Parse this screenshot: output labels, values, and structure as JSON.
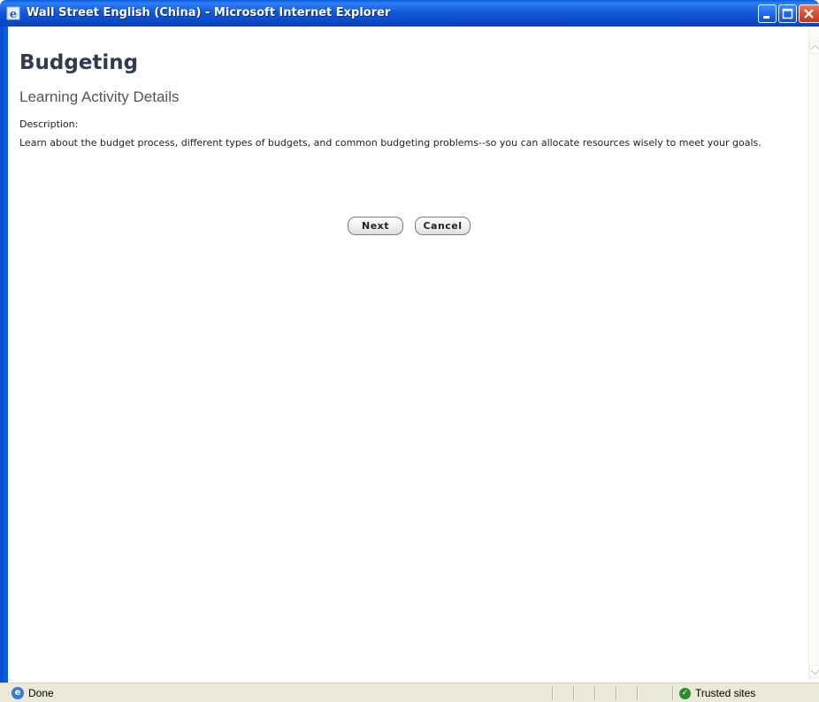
{
  "window": {
    "title": "Wall Street English (China) - Microsoft Internet Explorer"
  },
  "page": {
    "title": "Budgeting",
    "subtitle": "Learning Activity Details",
    "description_label": "Description:",
    "description_text": "Learn about the budget process, different types of budgets, and common budgeting problems--so you can allocate resources wisely to meet your goals."
  },
  "buttons": {
    "next_label": "Next",
    "cancel_label": "Cancel"
  },
  "statusbar": {
    "status_text": "Done",
    "zone_text": "Trusted sites"
  },
  "icons": {
    "ie": "ie-icon",
    "minimize": "minimize-icon",
    "maximize": "maximize-icon",
    "close": "close-icon",
    "trusted": "check-circle-icon"
  },
  "colors": {
    "titlebar": "#0b4ccc",
    "heading": "#2e3b52",
    "statusbar": "#ece9d8"
  }
}
